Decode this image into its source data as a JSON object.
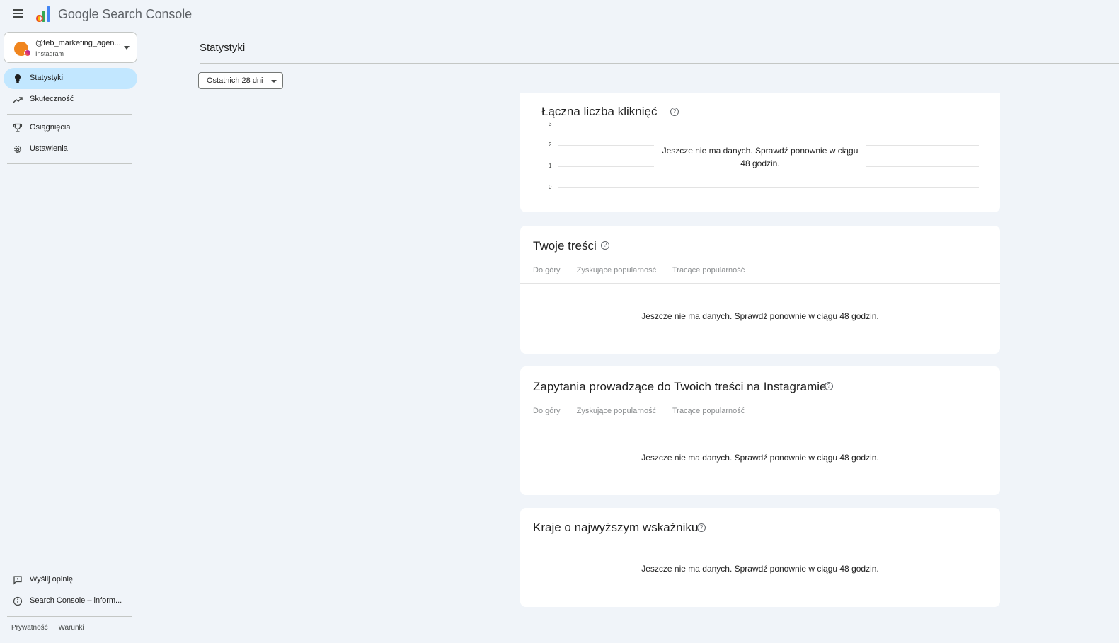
{
  "app": {
    "title": "Google Search Console"
  },
  "property": {
    "name": "@feb_marketing_agen...",
    "type": "Instagram"
  },
  "sidebar": {
    "items": [
      {
        "label": "Statystyki",
        "icon": "lightbulb-icon",
        "active": true
      },
      {
        "label": "Skuteczność",
        "icon": "trending-up-icon"
      },
      {
        "label": "Osiągnięcia",
        "icon": "trophy-icon"
      },
      {
        "label": "Ustawienia",
        "icon": "gear-icon"
      }
    ],
    "bottom_items": [
      {
        "label": "Wyślij opinię",
        "icon": "feedback-icon"
      },
      {
        "label": "Search Console – inform...",
        "icon": "info-icon"
      }
    ],
    "footer": {
      "privacy": "Prywatność",
      "terms": "Warunki"
    }
  },
  "main": {
    "page_title": "Statystyki",
    "date_filter": "Ostatnich 28 dni",
    "clicks_card": {
      "title": "Łączna liczba kliknięć",
      "empty_line1": "Jeszcze nie ma danych. Sprawdź ponownie w ciągu",
      "empty_line2": "48 godzin.",
      "y_ticks": [
        "3",
        "2",
        "1",
        "0"
      ]
    },
    "content_card": {
      "title": "Twoje treści",
      "tabs": [
        "Do góry",
        "Zyskujące popularność",
        "Tracące popularność"
      ],
      "empty": "Jeszcze nie ma danych. Sprawdź ponownie w ciągu 48 godzin."
    },
    "queries_card": {
      "title": "Zapytania prowadzące do Twoich treści na Instagramie",
      "tabs": [
        "Do góry",
        "Zyskujące popularność",
        "Tracące popularność"
      ],
      "empty": "Jeszcze nie ma danych. Sprawdź ponownie w ciągu 48 godzin."
    },
    "countries_card": {
      "title": "Kraje o najwyższym wskaźniku",
      "empty": "Jeszcze nie ma danych. Sprawdź ponownie w ciągu 48 godzin."
    }
  },
  "colors": {
    "accent": "#c2e7ff",
    "background": "#f0f4f9"
  }
}
